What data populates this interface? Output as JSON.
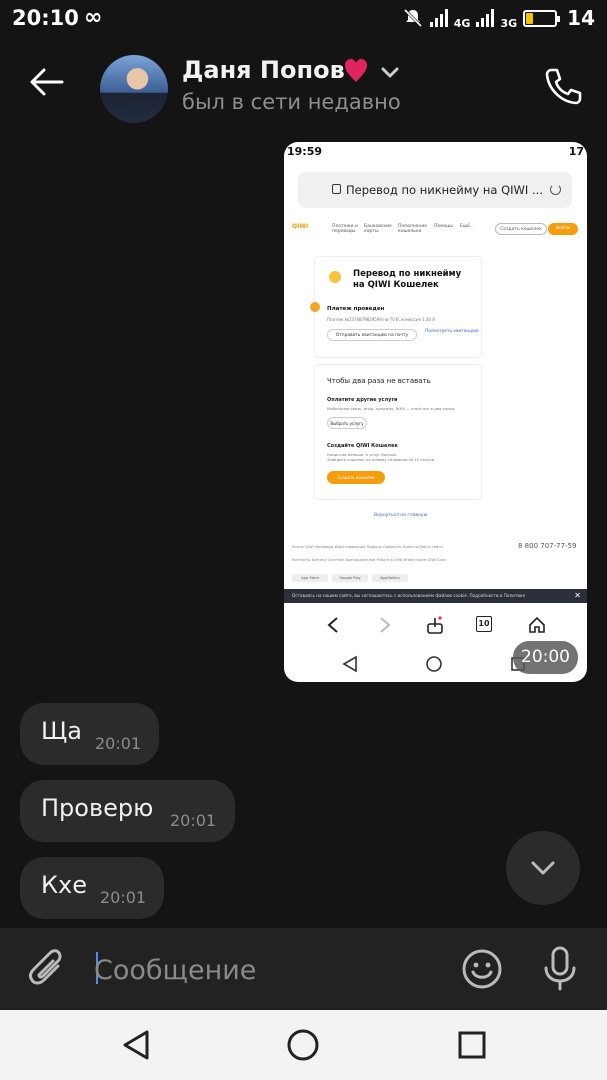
{
  "status_bar": {
    "time": "20:10",
    "infinity": "∞",
    "net1": "4G",
    "net2": "3G",
    "battery": "14"
  },
  "header": {
    "name": "Даня Попов",
    "status": "был в сети недавно"
  },
  "screenshot": {
    "time_badge": "20:00",
    "status_time": "19:59",
    "status_battery": "17",
    "url": "Перевод по никнейму на QIWI ...",
    "nav": {
      "logo": "QIWI",
      "items": [
        "Платежи и переводы",
        "Банковские карты",
        "Пополнение кошелька",
        "Помощь",
        "Ещё..."
      ],
      "create": "Создать кошелек",
      "login": "Войти"
    },
    "card1": {
      "title": "Перевод по никнейму на QIWI Кошелек",
      "ok": "Платеж проведен",
      "sub": "Платеж №1378879829599 на 70 ₽, комиссия 1,40 ₽",
      "send_btn": "Отправить квитанцию на почту",
      "link": "Посмотреть квитанцию"
    },
    "card2": {
      "heading": "Чтобы два раза не вставать",
      "h_pay": "Оплатите другие услуги",
      "p_pay": "Мобильная связь, игры, кредиты, ЖКХ — и всё это в два клика.",
      "btn_pay": "Выбрать услугу",
      "h_create": "Создайте QIWI Кошелек",
      "p_create1": "Комиссия меньше, а услуг больше.",
      "p_create2": "Заведите кошелек по номеру телефона за 10 секунд.",
      "btn_create": "Создать кошелек"
    },
    "back_link": "Вернуться на главную",
    "footer1": "Карты QIWI переводы   Идентификация   Помощь   Офферты   Новости   Карта сайта",
    "phone": "8 800 707-77-59",
    "footer2": "Контакты   Бизнесу   Агентам   Арендодателям   Работа в QIWI   Инвесторам   QIWI Банк",
    "stores": [
      "App Store",
      "Google Play",
      "AppGallery"
    ],
    "cookie": "Оставаясь на нашем сайте, вы соглашаетесь с использованием файлов cookie. Подробности в Политике",
    "tabs_count": "10"
  },
  "messages": [
    {
      "text": "Ща",
      "time": "20:01"
    },
    {
      "text": "Проверю",
      "time": "20:01"
    },
    {
      "text": "Кхе",
      "time": "20:01"
    }
  ],
  "composer": {
    "placeholder": "Сообщение"
  },
  "colors": {
    "background": "#141414",
    "bubble": "#2b2b2b",
    "accent": "#4a8ff0",
    "heart": "#e0245e",
    "qiwi_orange": "#f59d0c"
  },
  "icons": [
    "back-arrow-icon",
    "heart-icon",
    "chevron-down-icon",
    "phone-icon",
    "paperclip-icon",
    "emoji-icon",
    "microphone-icon",
    "chevron-down-icon"
  ]
}
